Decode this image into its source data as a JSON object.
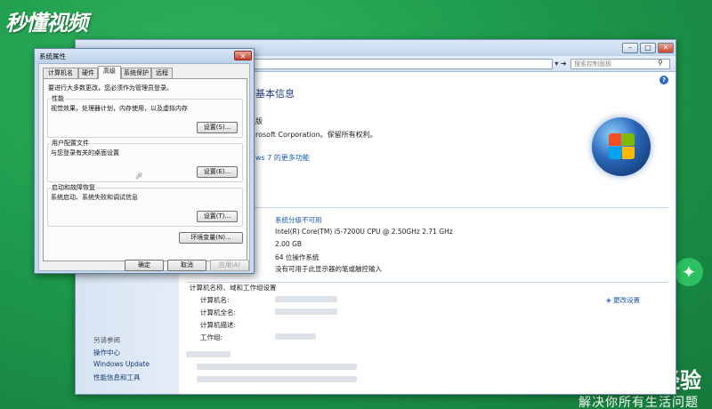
{
  "watermark": {
    "logo": "秒懂视频",
    "jingyan": "经验",
    "slogan": "解决你所有生活问题"
  },
  "system_window": {
    "search_placeholder": "搜索控制面板",
    "title": "查看有关计算机的基本信息",
    "edition_label": "Windows 版本",
    "edition_visible": "版",
    "copyright_visible": "rosoft Corporation。保留所有权利。",
    "more_features_visible": "ws 7 的更多功能",
    "system": {
      "rating": "系统分级不可用",
      "processor": "Intel(R) Core(TM) i5-7200U CPU @ 2.50GHz   2.71 GHz",
      "memory": "2.00 GB",
      "system_type": "64 位操作系统",
      "pen_touch": "没有可用于此显示器的笔或触控输入"
    },
    "computer_section": {
      "title": "计算机名称、域和工作组设置",
      "labels": [
        "计算机名:",
        "计算机全名:",
        "计算机描述:",
        "工作组:"
      ],
      "change_settings": "更改设置"
    },
    "see_also": {
      "title": "另请参阅",
      "items": [
        "操作中心",
        "Windows Update",
        "性能信息和工具"
      ]
    }
  },
  "dialog": {
    "title": "系统属性",
    "close_glyph": "✕",
    "tabs": [
      "计算机名",
      "硬件",
      "高级",
      "系统保护",
      "远程"
    ],
    "active_tab": 2,
    "intro": "要进行大多数更改，您必须作为管理员登录。",
    "groups": [
      {
        "label": "性能",
        "desc": "视觉效果，处理器计划，内存使用，以及虚拟内存",
        "button": "设置(S)..."
      },
      {
        "label": "用户配置文件",
        "desc": "与您登录有关的桌面设置",
        "button": "设置(E)..."
      },
      {
        "label": "启动和故障恢复",
        "desc": "系统启动、系统失败和调试信息",
        "button": "设置(T)..."
      }
    ],
    "env_button": "环境变量(N)...",
    "ok_button": "确定",
    "cancel_button": "取消",
    "apply_button": "应用(A)"
  }
}
